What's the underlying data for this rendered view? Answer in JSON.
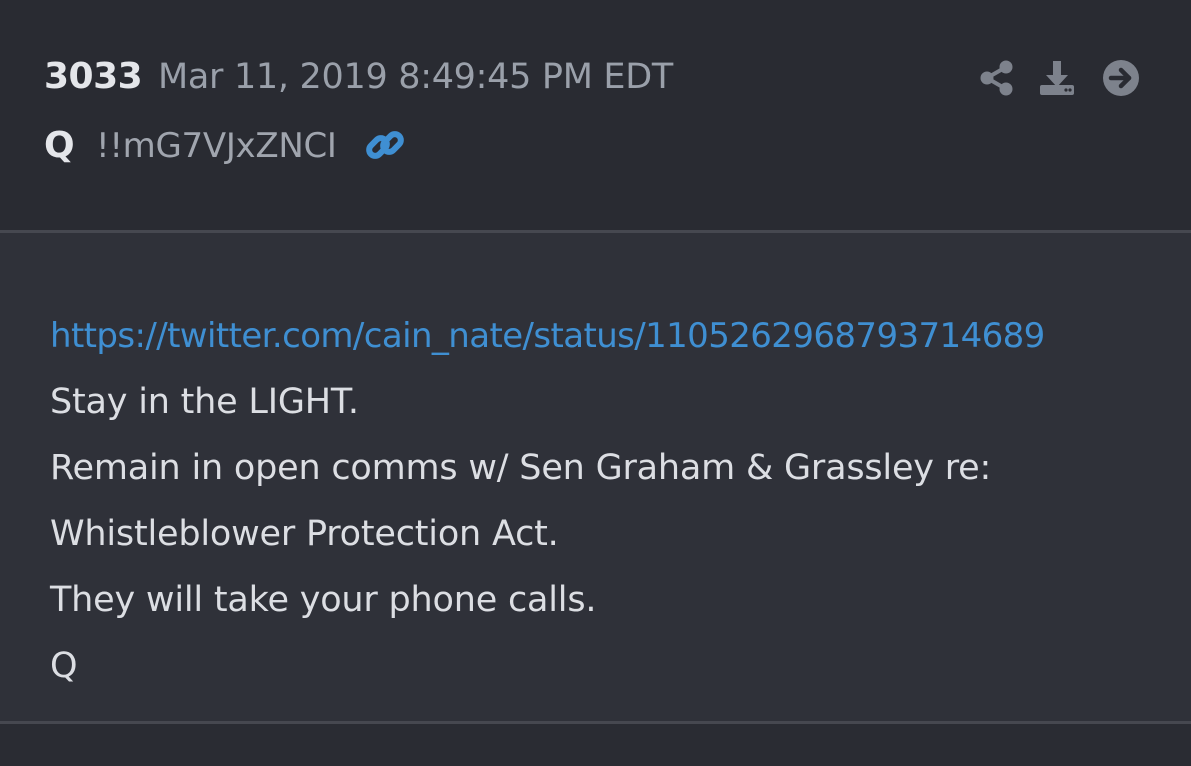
{
  "post": {
    "number": "3033",
    "date": "Mar 11, 2019 8:49:45 PM EDT",
    "author": "Q",
    "tripcode": "!!mG7VJxZNCI"
  },
  "icons": {
    "link": "link-icon",
    "share": "share-icon",
    "download": "download-icon",
    "goto": "arrow-circle-right-icon"
  },
  "body": {
    "link": "https://twitter.com/cain_nate/status/1105262968793714689",
    "lines": [
      "Stay in the LIGHT.",
      "Remain in open comms w/ Sen Graham & Grassley re:",
      "Whistleblower Protection Act.",
      "They will take your phone calls.",
      "Q"
    ]
  },
  "colors": {
    "link": "#3f8fd2",
    "header_bg": "#292b32",
    "body_bg": "#2f3139",
    "icon": "#7d828c"
  }
}
